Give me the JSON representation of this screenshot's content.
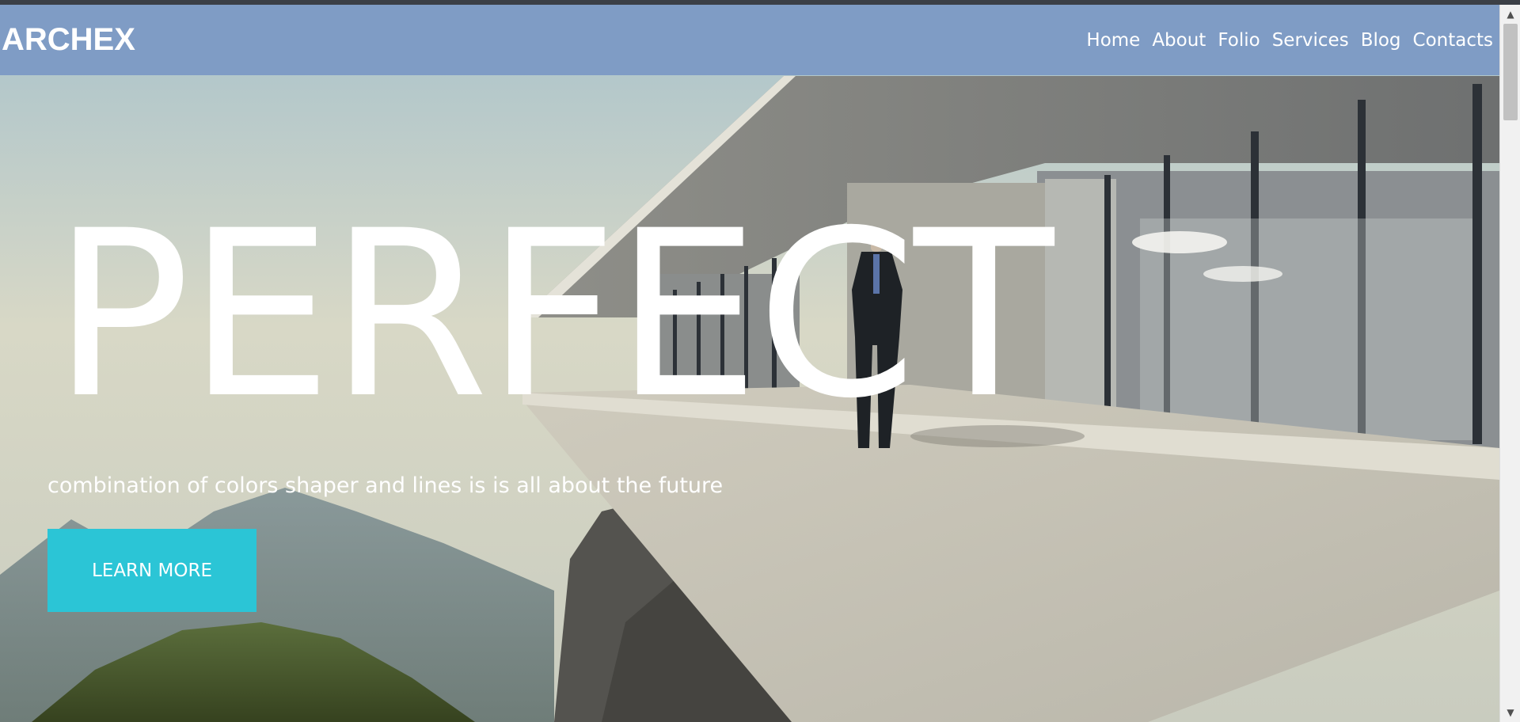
{
  "brand": {
    "logo": "ARCHEX"
  },
  "nav": {
    "items": [
      "Home",
      "About",
      "Folio",
      "Services",
      "Blog",
      "Contacts"
    ]
  },
  "hero": {
    "headline": "PERFECT",
    "subline": "combination of colors shaper and lines is is all about the future",
    "cta_label": "LEARN MORE"
  },
  "colors": {
    "navbar": "#7f9cc5",
    "cta": "#2bc5d6",
    "text": "#ffffff"
  },
  "scrollbar": {
    "up_icon": "chevron-up-icon",
    "down_icon": "chevron-down-icon"
  }
}
